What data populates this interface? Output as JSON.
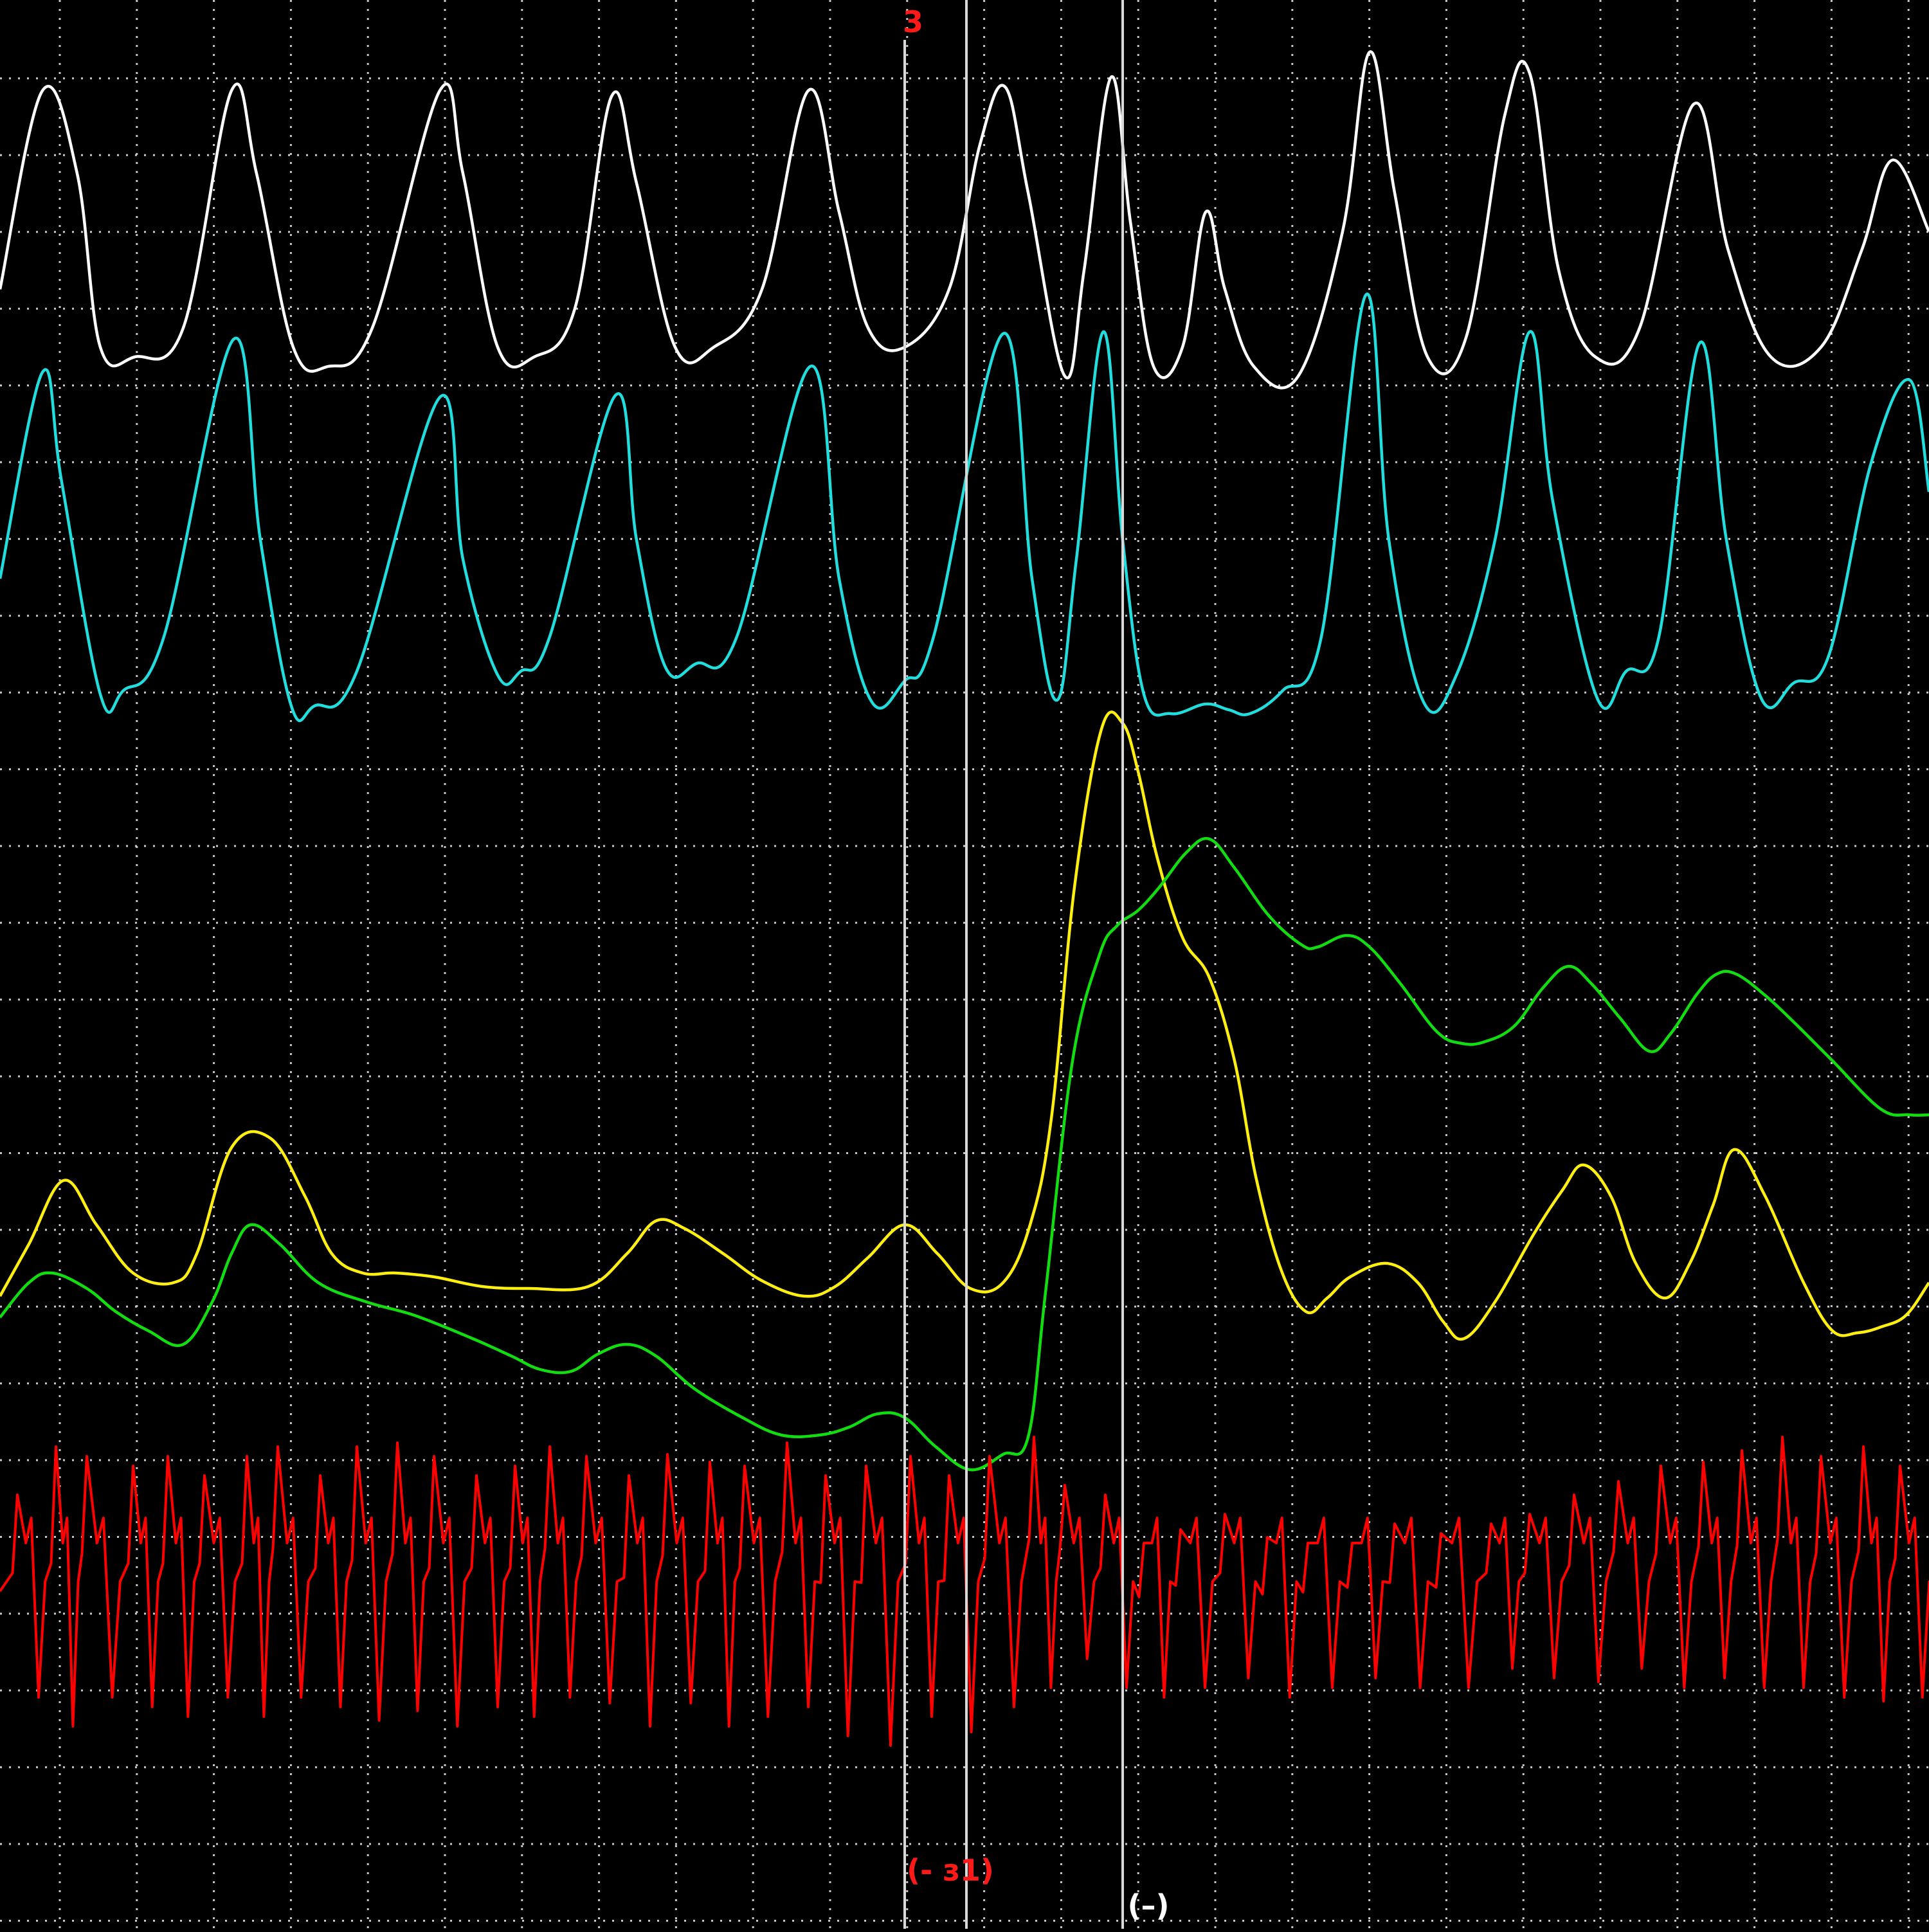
{
  "colors": {
    "background": "#000000",
    "grid": "#c8c8c8",
    "marker_line": "#d8d8d8",
    "marker_label": "#ff1a1a",
    "white": "#ffffff",
    "cyan": "#22dddd",
    "yellow": "#ffee11",
    "green": "#11dd11",
    "red": "#ff0000"
  },
  "markers": {
    "top_label": "3",
    "bottom_label_1": "(- з1)",
    "bottom_label_2": "(–)"
  },
  "chart_data": {
    "type": "line",
    "grid": true,
    "grid_style": "dotted",
    "x_range": [
      0,
      100
    ],
    "y_range": [
      0,
      100
    ],
    "vertical_markers": [
      {
        "x": 46.9,
        "label": "3",
        "label_position": "top"
      },
      {
        "x": 50.1,
        "label": "(- з1)",
        "label_position": "bottom"
      },
      {
        "x": 58.2,
        "label": "(–)",
        "label_position": "bottom"
      }
    ],
    "series": [
      {
        "color": "white",
        "points": [
          [
            0,
            85
          ],
          [
            2.2,
            95.3
          ],
          [
            4,
            91
          ],
          [
            5.2,
            82
          ],
          [
            7,
            81.5
          ],
          [
            9.5,
            83
          ],
          [
            12,
            95.3
          ],
          [
            13.3,
            91
          ],
          [
            15.2,
            82
          ],
          [
            17,
            81
          ],
          [
            19.3,
            83
          ],
          [
            22.8,
            95.3
          ],
          [
            24,
            91
          ],
          [
            25.8,
            82
          ],
          [
            27.7,
            81.5
          ],
          [
            29.8,
            84
          ],
          [
            31.7,
            95
          ],
          [
            33,
            90.5
          ],
          [
            35,
            82
          ],
          [
            37,
            82
          ],
          [
            39.5,
            85
          ],
          [
            41.9,
            95.3
          ],
          [
            43.5,
            89
          ],
          [
            45,
            83
          ],
          [
            46.9,
            82
          ],
          [
            49.2,
            85
          ],
          [
            50.8,
            92.5
          ],
          [
            52.1,
            95.5
          ],
          [
            53.3,
            90
          ],
          [
            55.2,
            80.5
          ],
          [
            56.2,
            86
          ],
          [
            57.6,
            96
          ],
          [
            58.6,
            88.5
          ],
          [
            59.8,
            81
          ],
          [
            61.3,
            82
          ],
          [
            62.5,
            89
          ],
          [
            63.5,
            85
          ],
          [
            65,
            81
          ],
          [
            67.3,
            80.5
          ],
          [
            69.6,
            88
          ],
          [
            71,
            97.3
          ],
          [
            72.3,
            90
          ],
          [
            74,
            81.5
          ],
          [
            76,
            82.5
          ],
          [
            78,
            94
          ],
          [
            79.3,
            96.2
          ],
          [
            80.8,
            86
          ],
          [
            82.7,
            81.5
          ],
          [
            85,
            83
          ],
          [
            87.8,
            94.6
          ],
          [
            89.6,
            87
          ],
          [
            91.8,
            81.5
          ],
          [
            94.4,
            82
          ],
          [
            96.5,
            87
          ],
          [
            98.1,
            91.7
          ],
          [
            100,
            88
          ]
        ]
      },
      {
        "color": "cyan",
        "points": [
          [
            0,
            70
          ],
          [
            2.2,
            80.7
          ],
          [
            3.2,
            75
          ],
          [
            5.2,
            64
          ],
          [
            6.4,
            64.2
          ],
          [
            8.5,
            67
          ],
          [
            12.1,
            82.4
          ],
          [
            13.5,
            72
          ],
          [
            15.1,
            63.4
          ],
          [
            16.3,
            63.4
          ],
          [
            18.5,
            65.2
          ],
          [
            22.8,
            79.4
          ],
          [
            24,
            71
          ],
          [
            25.8,
            65
          ],
          [
            27,
            65.2
          ],
          [
            28.5,
            67
          ],
          [
            31.9,
            79.5
          ],
          [
            33,
            72
          ],
          [
            34.5,
            65.4
          ],
          [
            36.1,
            65.6
          ],
          [
            38.2,
            67
          ],
          [
            42,
            81
          ],
          [
            43.5,
            70
          ],
          [
            45.2,
            63.6
          ],
          [
            46.9,
            64.7
          ],
          [
            48.4,
            67
          ],
          [
            52,
            82.7
          ],
          [
            53.5,
            70
          ],
          [
            54.8,
            63.7
          ],
          [
            55.8,
            71
          ],
          [
            57.2,
            82.8
          ],
          [
            58.2,
            72
          ],
          [
            59.3,
            64
          ],
          [
            60.7,
            63
          ],
          [
            62.5,
            63.5
          ],
          [
            63.7,
            63.2
          ],
          [
            64.8,
            63
          ],
          [
            66.5,
            64.2
          ],
          [
            68.5,
            67
          ],
          [
            70.8,
            84.7
          ],
          [
            72,
            72
          ],
          [
            73.8,
            63.6
          ],
          [
            75.5,
            65
          ],
          [
            77.5,
            72
          ],
          [
            79.3,
            82.8
          ],
          [
            80.5,
            74
          ],
          [
            82.8,
            63.8
          ],
          [
            84.3,
            65.2
          ],
          [
            86,
            67
          ],
          [
            88.1,
            82.2
          ],
          [
            89.5,
            72
          ],
          [
            91.3,
            63.8
          ],
          [
            93,
            64.6
          ],
          [
            94.8,
            66
          ],
          [
            97,
            76
          ],
          [
            99,
            80.3
          ],
          [
            100,
            74.5
          ]
        ]
      },
      {
        "color": "yellow",
        "points": [
          [
            0,
            32.8
          ],
          [
            1.5,
            35.5
          ],
          [
            3.3,
            38.8
          ],
          [
            5,
            36.5
          ],
          [
            6.9,
            34
          ],
          [
            9,
            33.5
          ],
          [
            10.2,
            35
          ],
          [
            12,
            40.5
          ],
          [
            14,
            41
          ],
          [
            15.8,
            38
          ],
          [
            17.2,
            35
          ],
          [
            18.8,
            34
          ],
          [
            20.5,
            34
          ],
          [
            22.5,
            33.8
          ],
          [
            25,
            33.3
          ],
          [
            27.4,
            33.2
          ],
          [
            30.5,
            33.3
          ],
          [
            32.5,
            35
          ],
          [
            34,
            36.7
          ],
          [
            35.5,
            36.3
          ],
          [
            37.5,
            35
          ],
          [
            39.5,
            33.6
          ],
          [
            41.7,
            32.8
          ],
          [
            43.3,
            33.3
          ],
          [
            45,
            34.8
          ],
          [
            46.9,
            36.5
          ],
          [
            48.6,
            35
          ],
          [
            50.3,
            33.2
          ],
          [
            52,
            33.5
          ],
          [
            53.4,
            36.5
          ],
          [
            54.5,
            42
          ],
          [
            55.7,
            54
          ],
          [
            57.1,
            62.2
          ],
          [
            58.2,
            62.5
          ],
          [
            59,
            60
          ],
          [
            60,
            55.5
          ],
          [
            61.3,
            51.4
          ],
          [
            62.7,
            49.3
          ],
          [
            64,
            45
          ],
          [
            65.1,
            39
          ],
          [
            66.4,
            34.2
          ],
          [
            67.7,
            32
          ],
          [
            68.8,
            32.7
          ],
          [
            70,
            33.8
          ],
          [
            71.9,
            34.5
          ],
          [
            73.5,
            33.5
          ],
          [
            74.8,
            31.5
          ],
          [
            75.9,
            30.6
          ],
          [
            77.5,
            32.5
          ],
          [
            79.5,
            36
          ],
          [
            81,
            38.3
          ],
          [
            82.1,
            39.6
          ],
          [
            83.5,
            38
          ],
          [
            84.8,
            34.5
          ],
          [
            86.3,
            32.7
          ],
          [
            87.6,
            34.5
          ],
          [
            88.8,
            37.5
          ],
          [
            89.9,
            40.4
          ],
          [
            91.5,
            38
          ],
          [
            93.5,
            33.5
          ],
          [
            95,
            31
          ],
          [
            96.3,
            30.9
          ],
          [
            97.5,
            31.2
          ],
          [
            98.8,
            31.8
          ],
          [
            100,
            33.5
          ]
        ]
      },
      {
        "color": "green",
        "points": [
          [
            0,
            31.7
          ],
          [
            1.5,
            33.5
          ],
          [
            2.7,
            34
          ],
          [
            4.5,
            33.2
          ],
          [
            6,
            32
          ],
          [
            7.7,
            31
          ],
          [
            9.5,
            30.3
          ],
          [
            11,
            32.5
          ],
          [
            12,
            35
          ],
          [
            13,
            36.5
          ],
          [
            14.5,
            35.5
          ],
          [
            16.5,
            33.5
          ],
          [
            19,
            32.5
          ],
          [
            21.5,
            31.8
          ],
          [
            24.5,
            30.6
          ],
          [
            26.5,
            29.7
          ],
          [
            28,
            29
          ],
          [
            29.6,
            28.9
          ],
          [
            31,
            29.8
          ],
          [
            32.5,
            30.3
          ],
          [
            34,
            29.7
          ],
          [
            36,
            28
          ],
          [
            38.5,
            26.5
          ],
          [
            40.5,
            25.6
          ],
          [
            42.5,
            25.6
          ],
          [
            44,
            26
          ],
          [
            45.5,
            26.7
          ],
          [
            46.9,
            26.5
          ],
          [
            48.5,
            25
          ],
          [
            50.3,
            23.8
          ],
          [
            52,
            24.6
          ],
          [
            53.3,
            25.5
          ],
          [
            54.2,
            33
          ],
          [
            55.6,
            45
          ],
          [
            57,
            50.5
          ],
          [
            57.9,
            52
          ],
          [
            59,
            52.8
          ],
          [
            60.1,
            54
          ],
          [
            61.5,
            55.8
          ],
          [
            62.7,
            56.5
          ],
          [
            64,
            55
          ],
          [
            65.8,
            52.5
          ],
          [
            67.5,
            51
          ],
          [
            68.3,
            50.9
          ],
          [
            69.8,
            51.5
          ],
          [
            71,
            50.9
          ],
          [
            72.6,
            49
          ],
          [
            74.5,
            46.5
          ],
          [
            75.8,
            45.9
          ],
          [
            77,
            46
          ],
          [
            78.5,
            46.8
          ],
          [
            80,
            48.8
          ],
          [
            81.3,
            49.9
          ],
          [
            82.5,
            49
          ],
          [
            84,
            47.2
          ],
          [
            85.5,
            45.5
          ],
          [
            86.6,
            46.4
          ],
          [
            88,
            48.5
          ],
          [
            89,
            49.5
          ],
          [
            90,
            49.5
          ],
          [
            91.5,
            48.4
          ],
          [
            93,
            47
          ],
          [
            95,
            45
          ],
          [
            97.5,
            42.5
          ],
          [
            99,
            42.2
          ],
          [
            100,
            42.2
          ]
        ]
      },
      {
        "color": "red",
        "baseline": 17.5,
        "peak_x": [
          0.9,
          2.9,
          4.5,
          6.9,
          8.7,
          10.6,
          12.8,
          14.4,
          16.6,
          18.5,
          20.6,
          22.5,
          24.7,
          26.7,
          28.5,
          30.4,
          32.6,
          34.6,
          36.8,
          38.6,
          40.8,
          42.8,
          44.9,
          47.2,
          49.2,
          51.3,
          53.6,
          55.2,
          57.3,
          59.3,
          61.2,
          63.5,
          65.7,
          67.8,
          70.1,
          72.3,
          74.7,
          77.3,
          79.3,
          81.6,
          83.9,
          86.1,
          88.3,
          90.3,
          92.4,
          94.4,
          96.6,
          98.5
        ],
        "peak_y": [
          22.5,
          25,
          24.5,
          24,
          24.5,
          23.5,
          24.5,
          25,
          23.5,
          25,
          25.2,
          24.5,
          23.5,
          24,
          25,
          24.5,
          23.5,
          24.6,
          24.2,
          24,
          25.2,
          23.5,
          24,
          24.5,
          23.5,
          24.5,
          25.5,
          23,
          22.5,
          20,
          20.7,
          21.5,
          20.3,
          20,
          20,
          21,
          20.5,
          21,
          21.5,
          22.5,
          23.2,
          24,
          24.2,
          24.8,
          25.5,
          24.5,
          25,
          24
        ],
        "trough_y": [
          12,
          10.5,
          12,
          11.5,
          11,
          12,
          11,
          12,
          11.5,
          10.8,
          11.3,
          10.5,
          11.5,
          11,
          12,
          11.7,
          10.5,
          11.7,
          10.5,
          11,
          11.5,
          10,
          9.5,
          11,
          10.2,
          11.5,
          12.5,
          14,
          12.5,
          12,
          12.5,
          13,
          12,
          12.5,
          13,
          12.5,
          12.5,
          13.5,
          13,
          12.8,
          13.5,
          12.5,
          13,
          12.5,
          12.5,
          12,
          11.8,
          12
        ]
      }
    ]
  }
}
